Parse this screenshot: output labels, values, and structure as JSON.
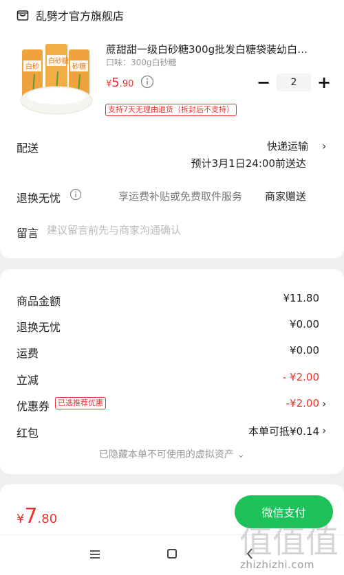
{
  "shop": {
    "name": "乱劈才官方旗舰店",
    "icon": "store-icon"
  },
  "product": {
    "title": "蔗甜甜一级白砂糖300g批发白糖袋装幼白…",
    "spec": "口味：300g白砂糖",
    "price": {
      "symbol": "¥",
      "integer": "5",
      "decimal": ".90"
    },
    "quantity": "2",
    "minus": "−",
    "plus": "+",
    "return_tag": "支持7天无理由退货（拆封后不支持）",
    "image_label": "白砂糖"
  },
  "delivery": {
    "label": "配送",
    "method": "快递运输",
    "eta": "预计3月1日24:00前送达",
    "chevron": "›"
  },
  "returns": {
    "label": "退换无忧",
    "desc": "享运费补贴或免费取件服务",
    "value": "商家赠送"
  },
  "message": {
    "label": "留言",
    "placeholder": "建议留言前先与商家沟通确认"
  },
  "price_detail": {
    "goods_label": "商品金额",
    "goods_value": "¥11.80",
    "rx_label": "退换无忧",
    "rx_value": "¥0.00",
    "freight_label": "运费",
    "freight_value": "¥0.00",
    "discount_label": "立减",
    "discount_value": "- ¥2.00",
    "coupon_label": "优惠券",
    "coupon_badge": "已选推荐优惠",
    "coupon_value": "-¥2.00",
    "redpack_label": "红包",
    "redpack_value": "本单可抵¥0.14",
    "chevron": "›",
    "hidden_assets": "已隐藏本单不可使用的虚拟资产 ⌄"
  },
  "checkout": {
    "total": {
      "symbol": "¥",
      "integer": "7",
      "decimal": ".80"
    },
    "pay_label": "微信支付"
  },
  "watermark": {
    "text": "zhizhizhi.com",
    "chars": "值值值"
  },
  "colors": {
    "accent_red": "#e8322f",
    "pay_green": "#1ec25b"
  }
}
